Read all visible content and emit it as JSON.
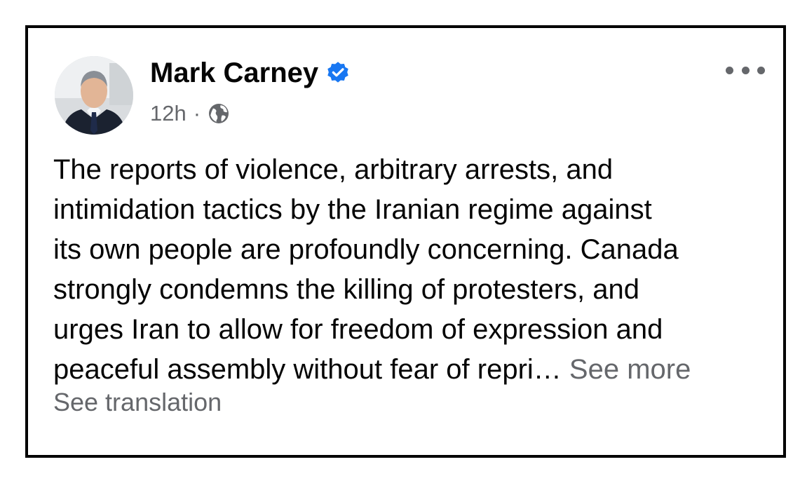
{
  "post": {
    "author_name": "Mark Carney",
    "verified_icon": "verified-badge-icon",
    "timestamp": "12h",
    "separator": "·",
    "audience_icon": "globe-icon",
    "more_icon": "more-options-icon",
    "body_lines": [
      "The reports of violence, arbitrary arrests, and",
      "intimidation tactics by the Iranian regime against",
      "its own people are profoundly concerning. Canada",
      "strongly condemns the killing of protesters, and",
      "urges Iran to allow for freedom of expression and",
      "peaceful assembly without fear of repri… "
    ],
    "see_more_label": "See more",
    "see_translation_label": "See translation"
  },
  "colors": {
    "border": "#000000",
    "text": "#050505",
    "secondary_text": "#65676b",
    "verified_blue": "#1877f2"
  }
}
